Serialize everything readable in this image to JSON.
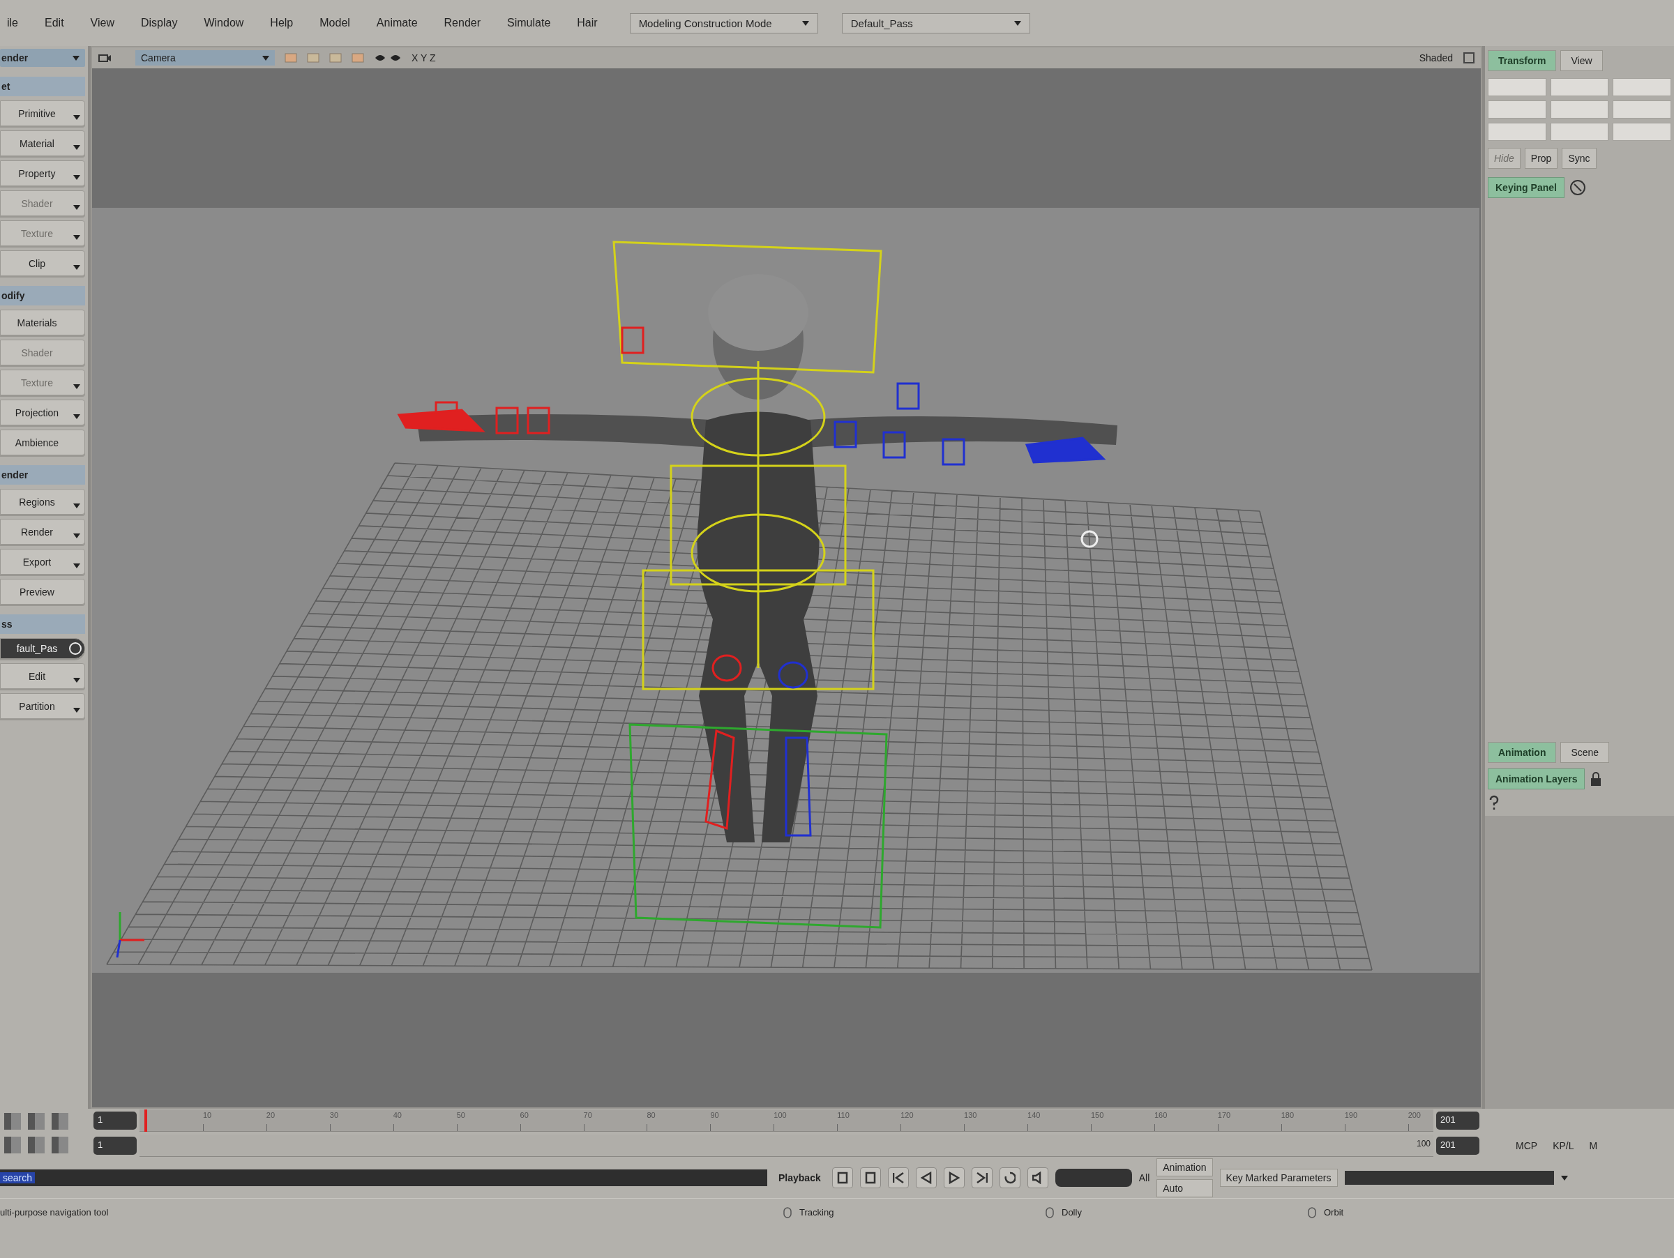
{
  "menu_bar": {
    "items": [
      "ile",
      "Edit",
      "View",
      "Display",
      "Window",
      "Help",
      "Model",
      "Animate",
      "Render",
      "Simulate",
      "Hair"
    ],
    "mode_dropdown": "Modeling Construction Mode",
    "pass_dropdown": "Default_Pass"
  },
  "left_panel": {
    "toolbar_dropdown": "ender",
    "sections": [
      {
        "title": "et",
        "buttons": [
          {
            "label": "Primitive",
            "kind": "menu",
            "disabled": false
          },
          {
            "label": "Material",
            "kind": "menu",
            "disabled": false
          },
          {
            "label": "Property",
            "kind": "menu",
            "disabled": false
          },
          {
            "label": "Shader",
            "kind": "menu",
            "disabled": true
          },
          {
            "label": "Texture",
            "kind": "menu",
            "disabled": true
          },
          {
            "label": "Clip",
            "kind": "menu",
            "disabled": false
          }
        ]
      },
      {
        "title": "odify",
        "buttons": [
          {
            "label": "Materials",
            "kind": "plain",
            "disabled": false
          },
          {
            "label": "Shader",
            "kind": "plain",
            "disabled": true
          },
          {
            "label": "Texture",
            "kind": "menu",
            "disabled": true
          },
          {
            "label": "Projection",
            "kind": "menu",
            "disabled": false
          },
          {
            "label": "Ambience",
            "kind": "plain",
            "disabled": false
          }
        ]
      },
      {
        "title": "ender",
        "buttons": [
          {
            "label": "Regions",
            "kind": "menu",
            "disabled": false
          },
          {
            "label": "Render",
            "kind": "menu",
            "disabled": false
          },
          {
            "label": "Export",
            "kind": "menu",
            "disabled": false
          },
          {
            "label": "Preview",
            "kind": "plain",
            "disabled": false
          }
        ]
      },
      {
        "title": "ss",
        "buttons": [
          {
            "label": "fault_Pas",
            "kind": "selector",
            "disabled": false
          },
          {
            "label": "Edit",
            "kind": "menu",
            "disabled": false
          },
          {
            "label": "Partition",
            "kind": "menu",
            "disabled": false
          }
        ]
      }
    ]
  },
  "viewport": {
    "camera": "Camera",
    "axes": "X Y Z",
    "display_mode": "Shaded"
  },
  "right_panel": {
    "tabs": [
      {
        "label": "Transform",
        "selected": true
      },
      {
        "label": "View",
        "selected": false
      }
    ],
    "buttons": [
      {
        "label": "Hide",
        "disabled": true
      },
      {
        "label": "Prop",
        "disabled": false
      },
      {
        "label": "Sync",
        "disabled": false
      }
    ],
    "keying_panel": "Keying Panel",
    "bottom_tabs": [
      {
        "label": "Animation",
        "selected": true
      },
      {
        "label": "Scene",
        "selected": false
      }
    ],
    "layers_button": "Animation Layers"
  },
  "timeline": {
    "start_frame": "1",
    "range_start": "1",
    "end_frame": "201",
    "range_end": "201",
    "range_label": "100",
    "ticks": [
      "10",
      "20",
      "30",
      "40",
      "50",
      "60",
      "70",
      "80",
      "90",
      "100",
      "110",
      "120",
      "130",
      "140",
      "150",
      "160",
      "170",
      "180",
      "190",
      "200"
    ],
    "playhead": {
      "level": 0.004
    },
    "range": {
      "level": 1
    }
  },
  "command_bar": {
    "text": "search"
  },
  "playback": {
    "label": "Playback",
    "fps_label": "All",
    "animation_label": "Animation",
    "auto_button": "Auto",
    "key_button": "Key Marked Parameters",
    "mode_buttons": [
      "MCP",
      "KP/L",
      "M"
    ]
  },
  "status_bar": {
    "message": "ulti-purpose navigation tool",
    "hints": [
      "Tracking",
      "Dolly",
      "Orbit"
    ]
  }
}
